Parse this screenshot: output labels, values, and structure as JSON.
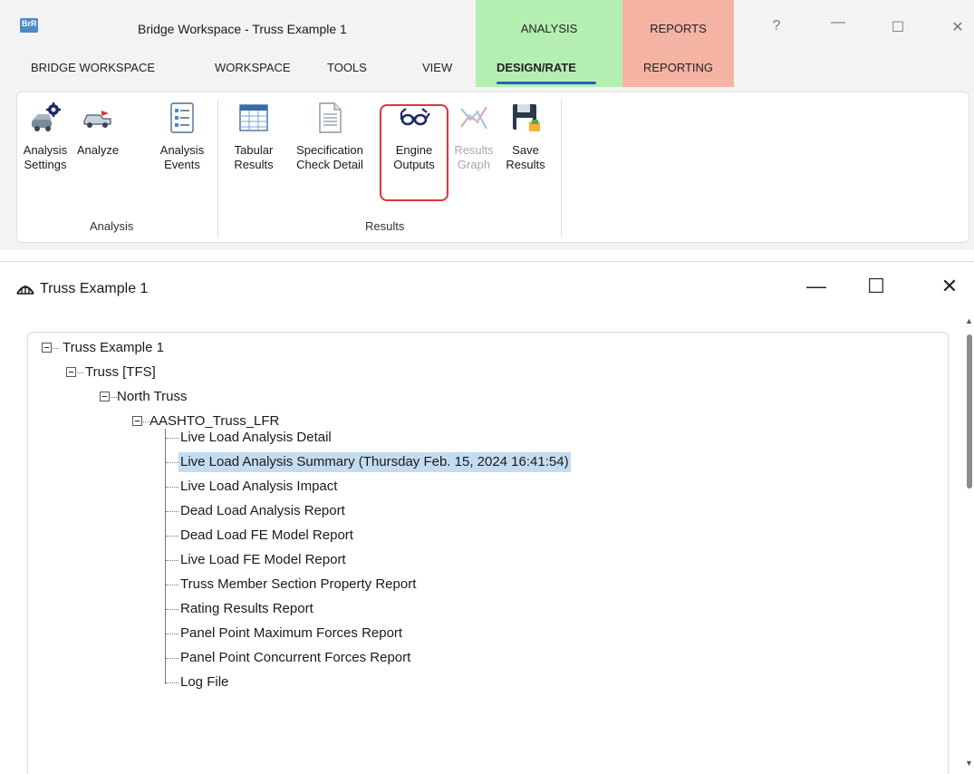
{
  "app": {
    "title": "Bridge Workspace - Truss Example 1",
    "logo_text": "BrR",
    "context_tabs": {
      "analysis": "ANALYSIS",
      "reports": "REPORTS"
    },
    "window_controls": {
      "help": "?",
      "minimize": "—",
      "maximize": "☐",
      "close": "✕"
    },
    "colors": {
      "analysis_bg": "#b4efb1",
      "reports_bg": "#f5b3a3",
      "accent": "#1e62c6",
      "highlight": "#e0323a",
      "selection": "#c3dcf0"
    }
  },
  "ribbon": {
    "tabs": {
      "bridge_workspace": "BRIDGE WORKSPACE",
      "workspace": "WORKSPACE",
      "tools": "TOOLS",
      "view": "VIEW",
      "design_rate": "DESIGN/RATE",
      "reporting": "REPORTING"
    },
    "active_tab": "DESIGN/RATE",
    "analysis_group": {
      "label": "Analysis",
      "settings": [
        "Analysis",
        "Settings"
      ],
      "analyze": [
        "Analyze",
        ""
      ],
      "events": [
        "Analysis",
        "Events"
      ]
    },
    "results_group": {
      "label": "Results",
      "tabular": [
        "Tabular",
        "Results"
      ],
      "spec_check": [
        "Specification",
        "Check Detail"
      ],
      "engine_outputs": [
        "Engine",
        "Outputs"
      ],
      "results_graph": [
        "Results",
        "Graph"
      ],
      "save_results": [
        "Save",
        "Results"
      ]
    }
  },
  "tree_window": {
    "title": "Truss Example 1",
    "controls": {
      "minimize": "—",
      "maximize": "☐",
      "close": "✕"
    },
    "root": "Truss Example 1",
    "truss": "Truss [TFS]",
    "member": "North Truss",
    "rating": "AASHTO_Truss_LFR",
    "reports": [
      "Live Load Analysis Detail",
      "Live Load Analysis Summary (Thursday Feb. 15, 2024 16:41:54)",
      "Live Load Analysis Impact",
      "Dead Load Analysis Report",
      "Dead Load FE Model Report",
      "Live Load FE Model Report",
      "Truss Member Section Property Report",
      "Rating Results Report",
      "Panel Point Maximum Forces Report",
      "Panel Point Concurrent Forces Report",
      "Log File"
    ],
    "selected_index": 1
  }
}
